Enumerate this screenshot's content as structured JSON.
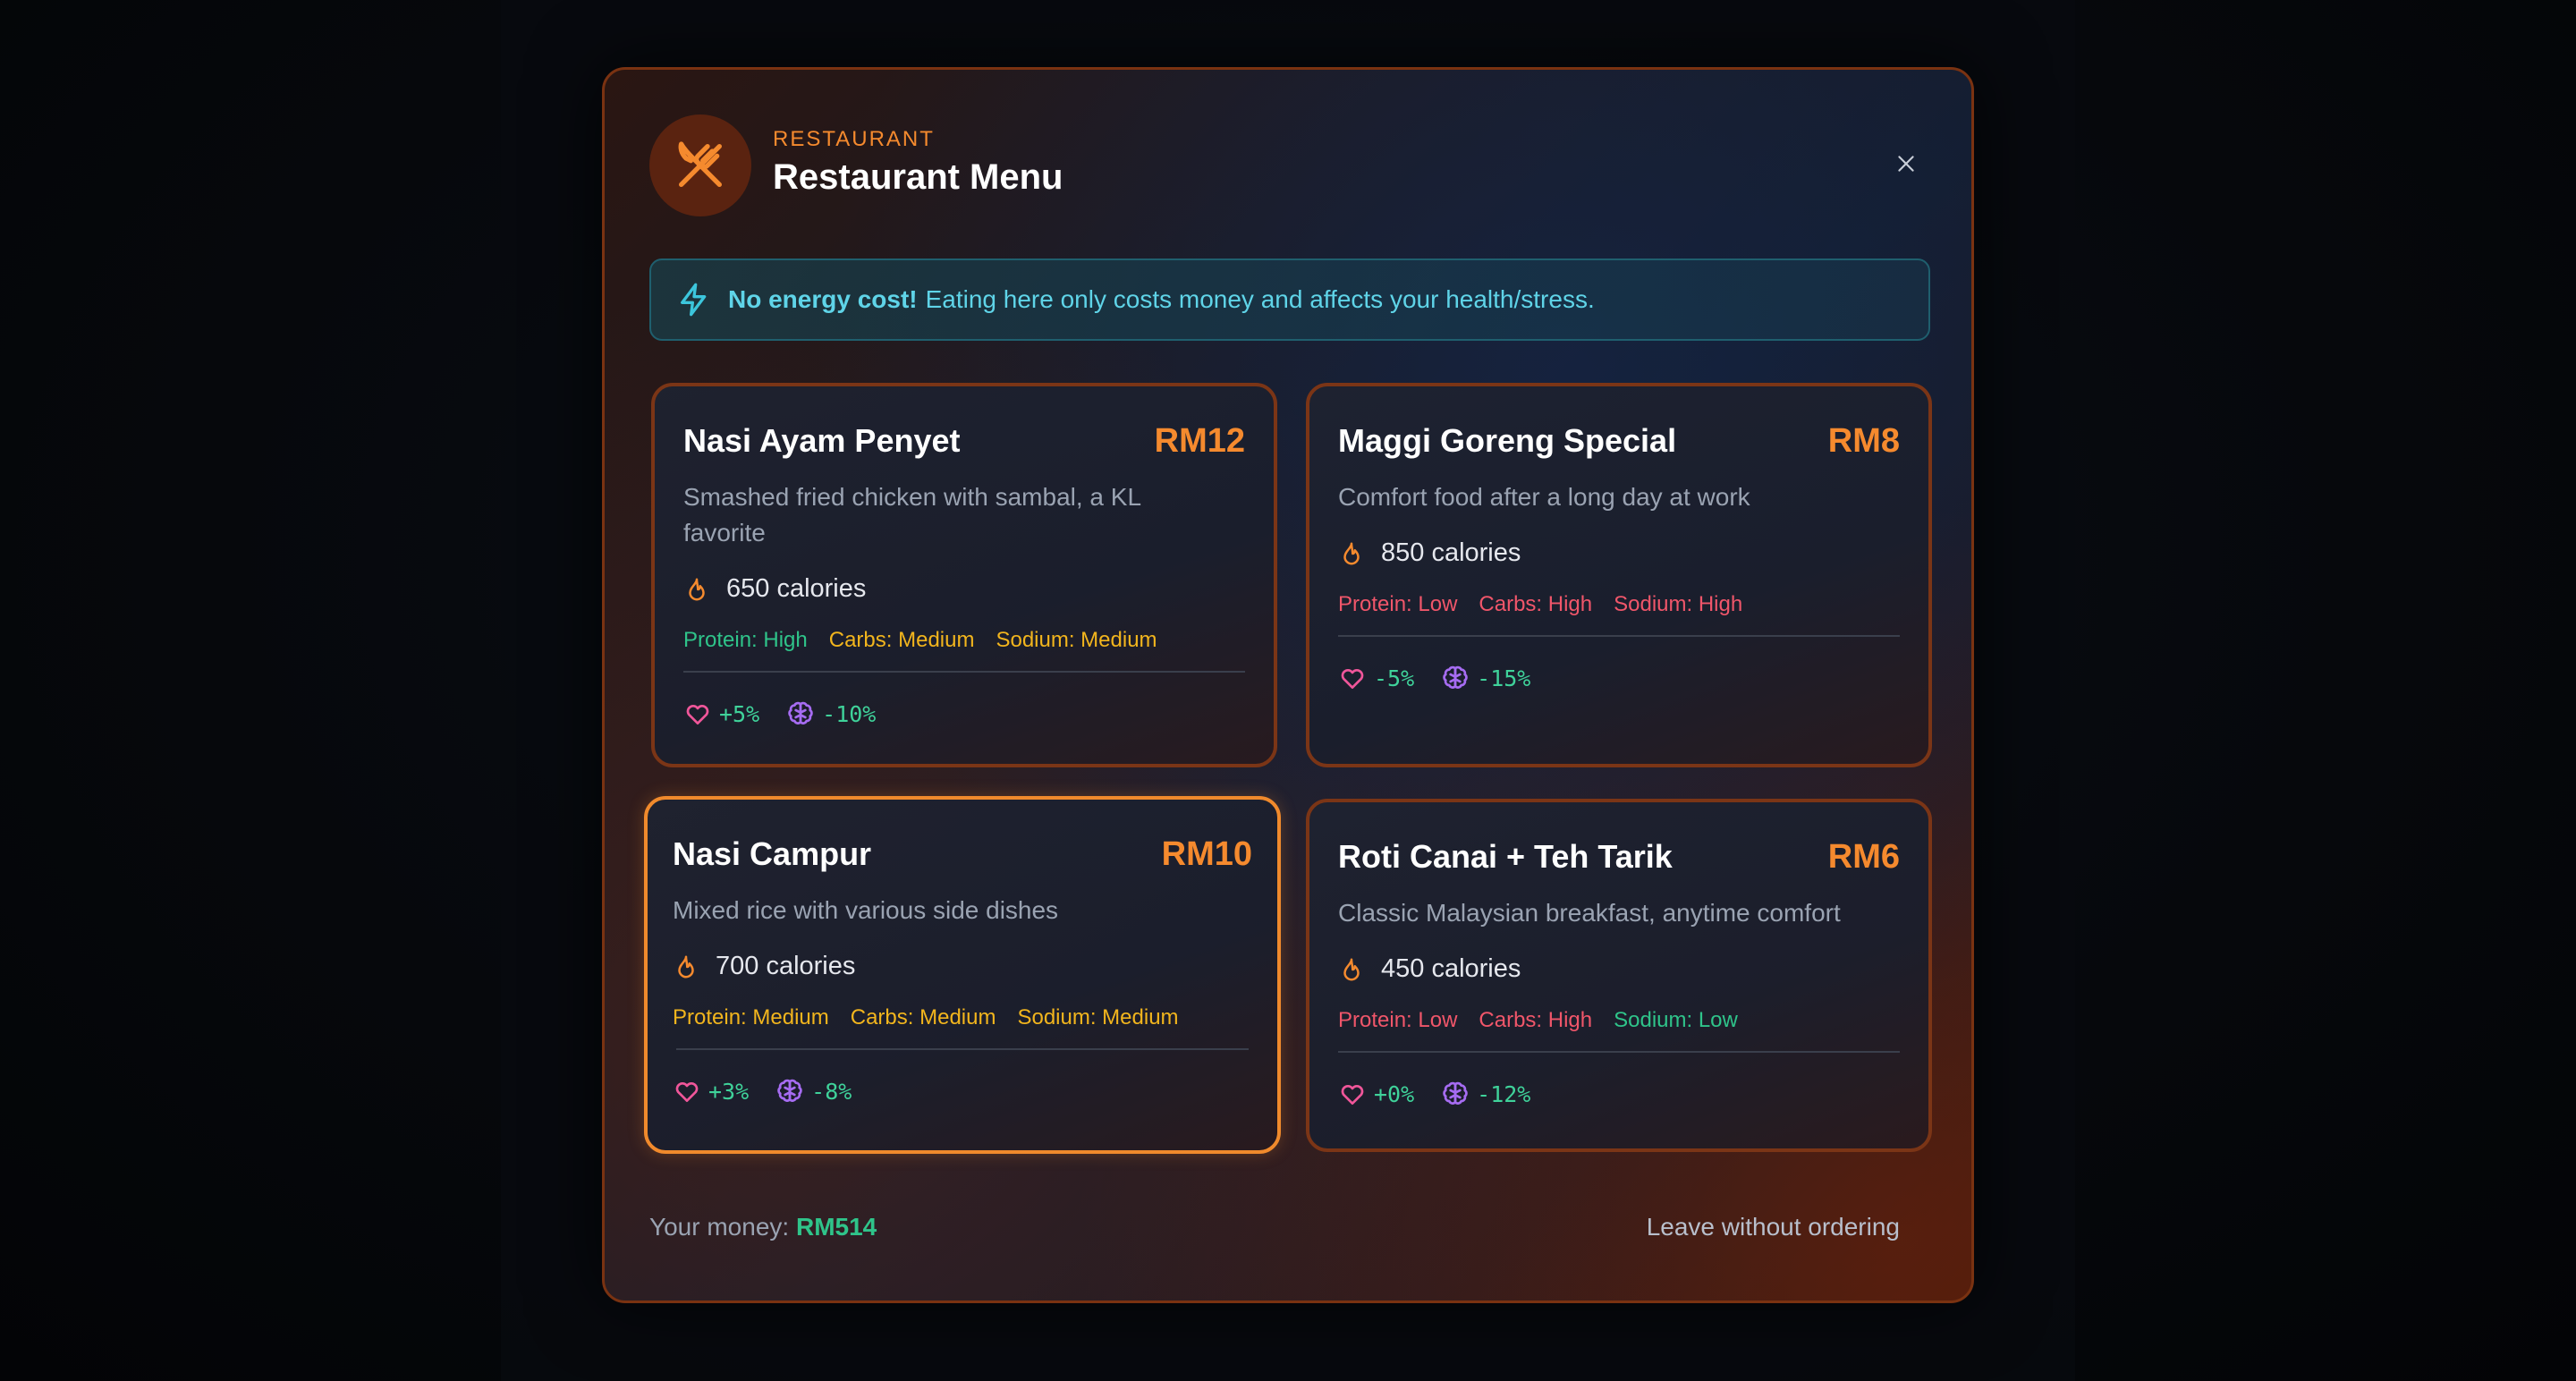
{
  "header": {
    "kicker": "RESTAURANT",
    "title": "Restaurant Menu",
    "logo_icon": "fork-knife-icon",
    "close_icon": "close-icon"
  },
  "notice": {
    "icon": "lightning-bolt-icon",
    "bold": "No energy cost!",
    "text": "Eating here only costs money and affects your health/stress."
  },
  "menu": [
    {
      "name": "Nasi Ayam Penyet",
      "price": "RM12",
      "description": "Smashed fried chicken with sambal, a KL favorite",
      "calories": "650 calories",
      "tags": [
        {
          "label": "Protein: High",
          "level": "high"
        },
        {
          "label": "Carbs: Medium",
          "level": "medium"
        },
        {
          "label": "Sodium: Medium",
          "level": "medium"
        }
      ],
      "health": "+5%",
      "stress": "-10%",
      "selected": false
    },
    {
      "name": "Maggi Goreng Special",
      "price": "RM8",
      "description": "Comfort food after a long day at work",
      "calories": "850 calories",
      "tags": [
        {
          "label": "Protein: Low",
          "level": "low"
        },
        {
          "label": "Carbs: High",
          "level": "low"
        },
        {
          "label": "Sodium: High",
          "level": "low"
        }
      ],
      "health": "-5%",
      "stress": "-15%",
      "selected": false
    },
    {
      "name": "Nasi Campur",
      "price": "RM10",
      "description": "Mixed rice with various side dishes",
      "calories": "700 calories",
      "tags": [
        {
          "label": "Protein: Medium",
          "level": "medium"
        },
        {
          "label": "Carbs: Medium",
          "level": "medium"
        },
        {
          "label": "Sodium: Medium",
          "level": "medium"
        }
      ],
      "health": "+3%",
      "stress": "-8%",
      "selected": true
    },
    {
      "name": "Roti Canai + Teh Tarik",
      "price": "RM6",
      "description": "Classic Malaysian breakfast, anytime comfort",
      "calories": "450 calories",
      "tags": [
        {
          "label": "Protein: Low",
          "level": "low"
        },
        {
          "label": "Carbs: High",
          "level": "low"
        },
        {
          "label": "Sodium: Low",
          "level": "high"
        }
      ],
      "health": "+0%",
      "stress": "-12%",
      "selected": false
    }
  ],
  "footer": {
    "money_label": "Your money:",
    "money_value": "RM514",
    "leave_label": "Leave without ordering"
  },
  "colors": {
    "accent": "#f58a2e",
    "positive": "#2fc48a",
    "warning": "#f2b51d",
    "negative": "#f0566a",
    "info": "#5fd4e8"
  }
}
